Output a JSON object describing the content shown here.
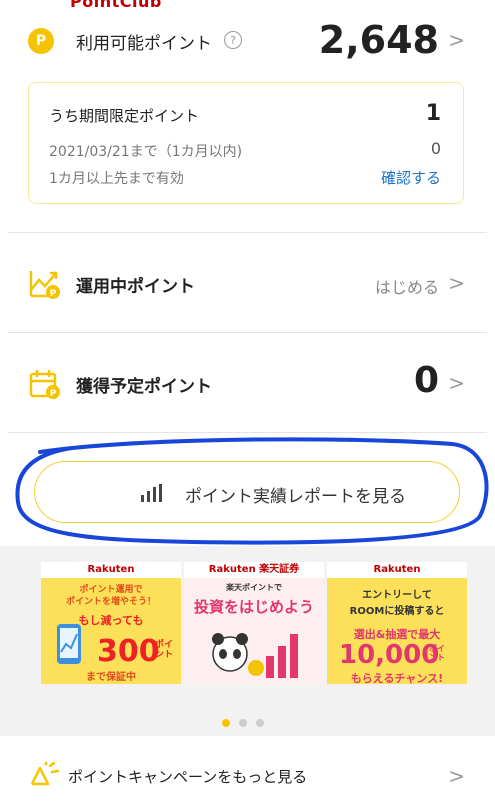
{
  "brand": {
    "partial_title": "PointClub"
  },
  "available": {
    "coin_letter": "P",
    "label": "利用可能ポイント",
    "help": "?",
    "value": "2,648",
    "chevron": ">"
  },
  "limited": {
    "title": "うち期間限定ポイント",
    "title_value": "1",
    "date_text": "2021/03/21まで（1カ月以内)",
    "date_value": "0",
    "valid_text": "1カ月以上先まで有効",
    "confirm_link": "確認する"
  },
  "rows": [
    {
      "label": "運用中ポイント",
      "right_text": "はじめる",
      "chevron": ">"
    },
    {
      "label": "獲得予定ポイント",
      "right_value": "0",
      "chevron": ">"
    }
  ],
  "report_button": {
    "label": "ポイント実績レポートを見る"
  },
  "banners": [
    {
      "brand": "Rakuten",
      "line1": "ポイント運用で",
      "line2": "ポイントを増やそう！",
      "line3": "もし減っても",
      "big": "300",
      "unit1": "ポイ",
      "unit2": "ント",
      "foot": "まで保証中"
    },
    {
      "brand": "Rakuten 楽天証券",
      "line1": "楽天ポイントで",
      "line2": "投資をはじめよう"
    },
    {
      "brand": "Rakuten",
      "line1": "エントリーして",
      "line2": "ROOMに投稿すると",
      "highlight": "選出&抽選で最大",
      "big": "10,000",
      "unit1": "ポイ",
      "unit2": "ント",
      "foot": "もらえるチャンス!"
    }
  ],
  "carousel": {
    "active_index": 0,
    "count": 3
  },
  "campaign": {
    "label": "ポイントキャンペーンをもっと見る",
    "chevron": ">"
  },
  "colors": {
    "accent_yellow": "#f5c400",
    "link_blue": "#1a73c8",
    "brand_red": "#bf0000",
    "annotation_blue": "#1846d8"
  }
}
